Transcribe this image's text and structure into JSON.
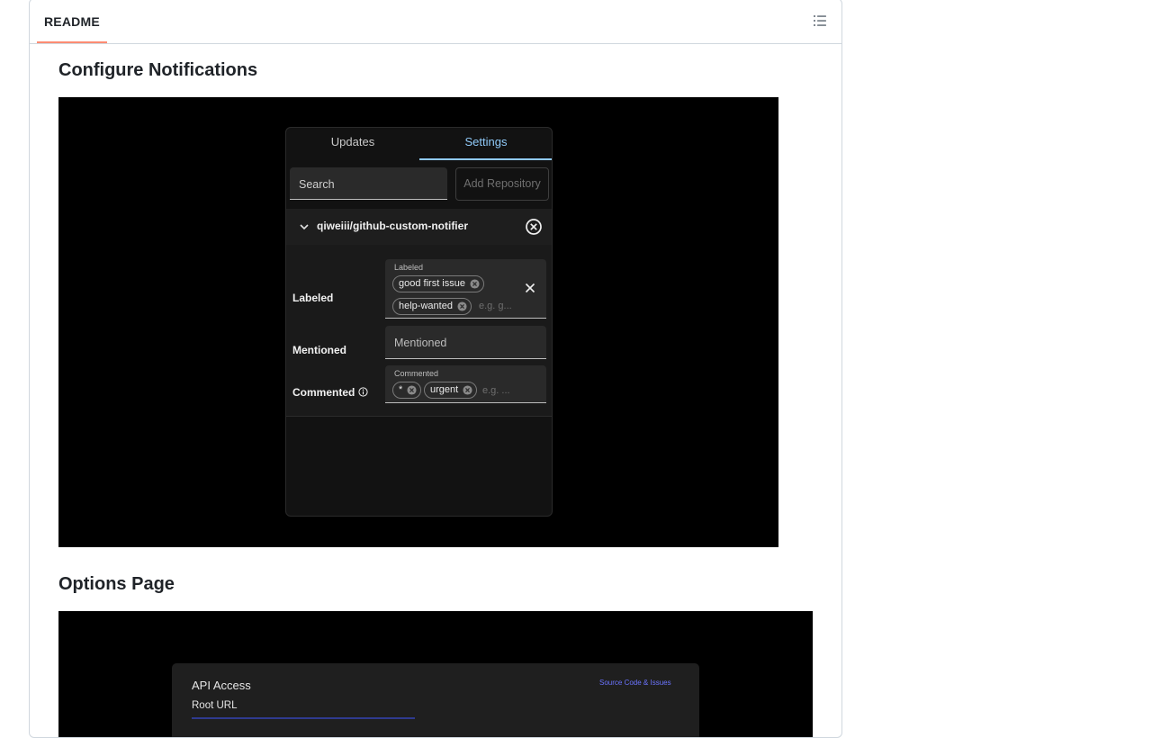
{
  "readme": {
    "tab_label": "README",
    "outline_icon": "list-unordered-icon"
  },
  "sections": {
    "notifications_title": "Configure Notifications",
    "options_title": "Options Page"
  },
  "popup": {
    "tabs": [
      "Updates",
      "Settings"
    ],
    "active_tab": "Settings",
    "search_placeholder": "Search",
    "add_repository": "Add Repository",
    "repo_name": "qiweiii/github-custom-notifier",
    "labeled": {
      "label": "Labeled",
      "field_label": "Labeled",
      "chips": [
        "good first issue",
        "help-wanted"
      ],
      "hint": "e.g. g..."
    },
    "mentioned": {
      "label": "Mentioned",
      "placeholder": "Mentioned"
    },
    "commented": {
      "label": "Commented",
      "field_label": "Commented",
      "chips": [
        "*",
        "urgent"
      ],
      "hint": "e.g. ..."
    },
    "colors": {
      "accent": "#90caf9",
      "background": "#121212"
    }
  },
  "options": {
    "api_access": "API Access",
    "root_url": "Root URL",
    "source_link": "Source Code & Issues"
  }
}
